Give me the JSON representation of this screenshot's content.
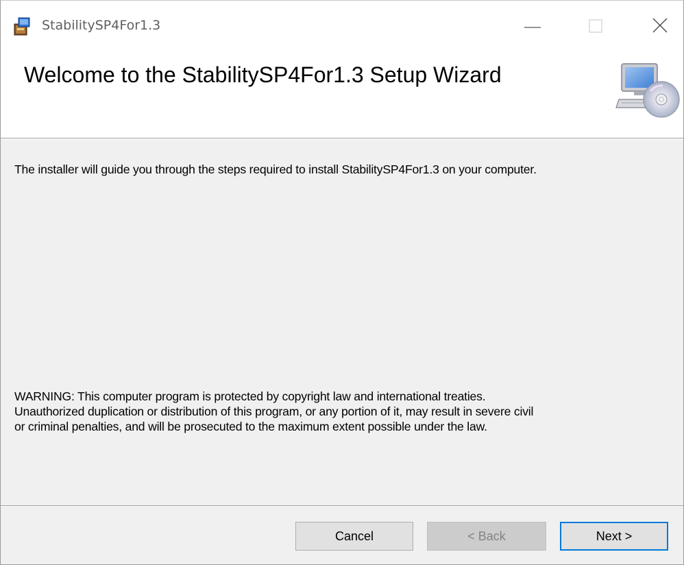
{
  "window": {
    "title": "StabilitySP4For1.3"
  },
  "banner": {
    "title": "Welcome to the StabilitySP4For1.3 Setup Wizard"
  },
  "body": {
    "intro": "The installer will guide you through the steps required to install StabilitySP4For1.3 on your computer.",
    "warning_lines": [
      "WARNING: This computer program is protected by copyright law and international treaties.",
      "Unauthorized duplication or distribution of this program, or any portion of it, may result in severe civil",
      "or criminal penalties, and will be prosecuted to the maximum extent possible under the law."
    ]
  },
  "buttons": {
    "cancel": "Cancel",
    "back": "< Back",
    "next": "Next >"
  },
  "icons": {
    "app": "installer-package-icon",
    "banner": "computer-cd-icon",
    "minimize": "minimize-icon",
    "maximize": "maximize-icon",
    "close": "close-icon"
  },
  "colors": {
    "accent": "#0078d7",
    "title_text": "#5f5f5f",
    "disabled_text": "#838383"
  }
}
